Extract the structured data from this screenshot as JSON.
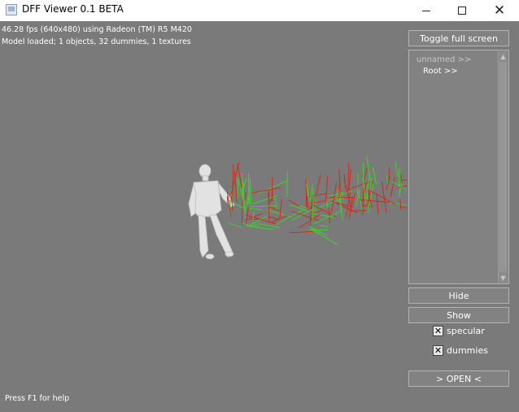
{
  "window": {
    "title": "DFF Viewer 0.1 BETA",
    "controls": {
      "minimize": "—",
      "maximize": "☐",
      "close": "✕"
    }
  },
  "hud": {
    "fps_line": "46.28 fps (640x480) using Radeon (TM) R5 M420",
    "model_line": "Model loaded; 1 objects, 32 dummies, 1 textures",
    "help_line": "Press F1 for help"
  },
  "panel": {
    "toggle_fullscreen": "Toggle full screen",
    "tree": {
      "items": [
        {
          "label": "unnamed >>"
        },
        {
          "label": "Root >>"
        }
      ],
      "scroll_up": "▲",
      "scroll_down": "▼"
    },
    "hide": "Hide",
    "show": "Show",
    "specular": {
      "label": "specular",
      "checked": true,
      "mark": "✕"
    },
    "dummies": {
      "label": "dummies",
      "checked": true,
      "mark": "✕"
    },
    "open": "> OPEN <"
  },
  "colors": {
    "background": "#7a7a7a",
    "dummy_red": "#d42a1a",
    "dummy_green": "#3fd12a",
    "model_white": "#e6e6e6"
  },
  "icons": [
    "app-icon",
    "minimize-icon",
    "maximize-icon",
    "close-icon",
    "checkbox-icon",
    "scroll-arrow-icon"
  ]
}
